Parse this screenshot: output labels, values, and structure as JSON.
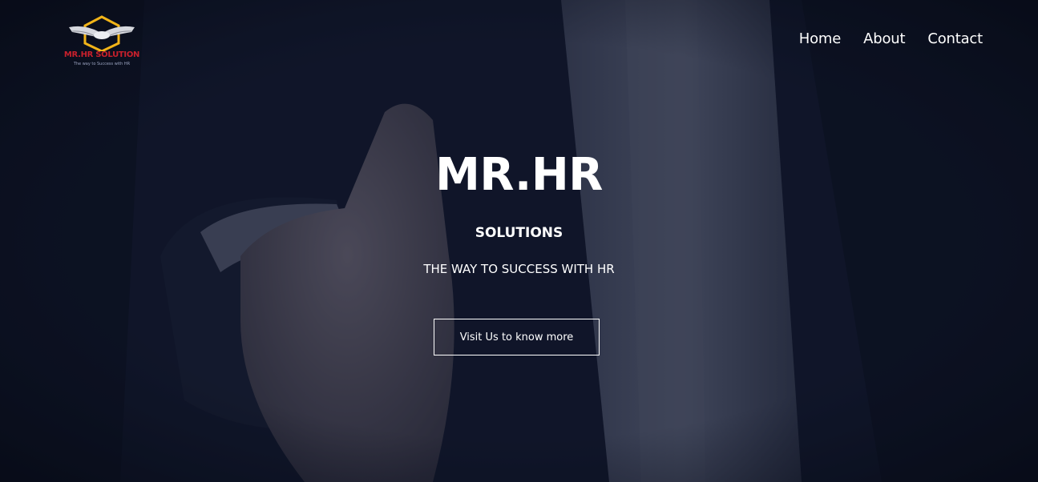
{
  "brand": {
    "logo_text": "MR.HR SOLUTION",
    "logo_tagline": "The way to Success with HR",
    "accent_color": "#c8202c",
    "badge_color": "#f2b418",
    "icon": "handshake-wings-icon"
  },
  "nav": {
    "items": [
      {
        "label": "Home"
      },
      {
        "label": "About"
      },
      {
        "label": "Contact"
      }
    ]
  },
  "hero": {
    "title": "MR.HR",
    "subtitle": "SOLUTIONS",
    "tagline": "THE WAY TO SUCCESS WITH HR",
    "cta_label": "Visit Us to know more",
    "background": "handshake-photo"
  }
}
